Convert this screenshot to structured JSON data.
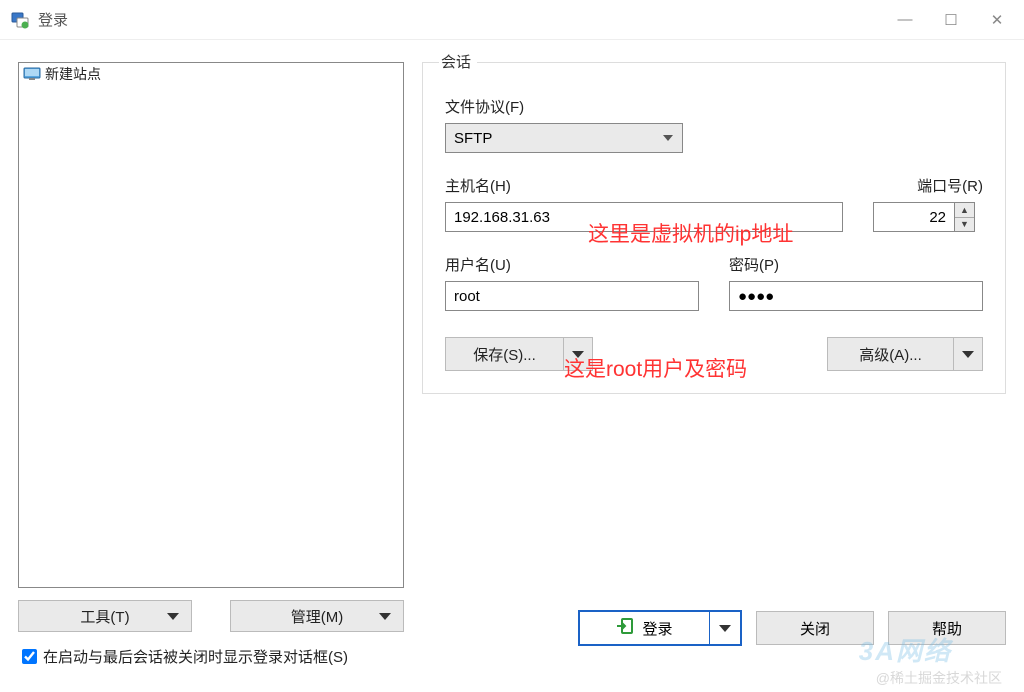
{
  "window": {
    "title": "登录"
  },
  "sidebar": {
    "items": [
      {
        "label": "新建站点"
      }
    ]
  },
  "left_buttons": {
    "tools": "工具(T)",
    "manage": "管理(M)"
  },
  "checkbox": {
    "label": "在启动与最后会话被关闭时显示登录对话框(S)"
  },
  "session": {
    "legend": "会话",
    "protocol_label": "文件协议(F)",
    "protocol_value": "SFTP",
    "host_label": "主机名(H)",
    "host_value": "192.168.31.63",
    "port_label": "端口号(R)",
    "port_value": "22",
    "user_label": "用户名(U)",
    "user_value": "root",
    "pass_label": "密码(P)",
    "pass_value": "●●●●",
    "save_btn": "保存(S)...",
    "adv_btn": "高级(A)..."
  },
  "bottom": {
    "login": "登录",
    "close": "关闭",
    "help": "帮助"
  },
  "annotations": {
    "ip_note": "这里是虚拟机的ip地址",
    "root_note": "这是root用户及密码"
  },
  "watermarks": {
    "community": "@稀土掘金技术社区",
    "logo": "3A网络"
  }
}
